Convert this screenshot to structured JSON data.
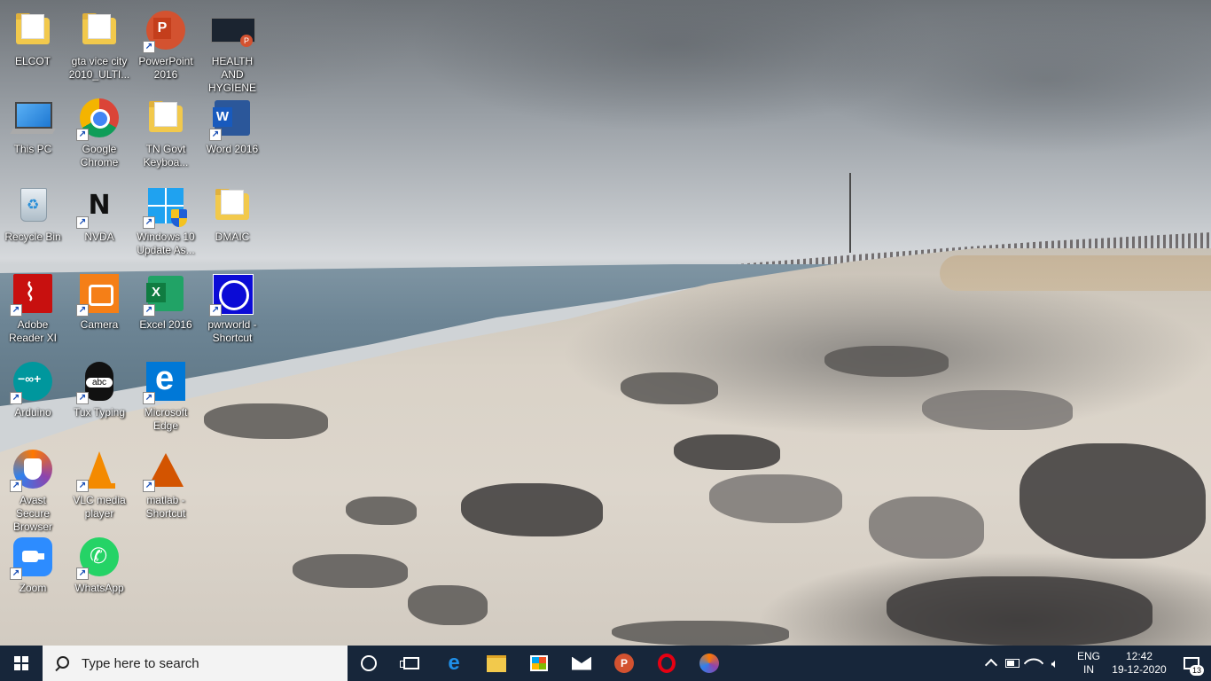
{
  "desktop": {
    "icons": [
      {
        "label": "ELCOT",
        "icon": "folder-user-icon"
      },
      {
        "label": "gta vice city 2010_ULTI...",
        "icon": "folder-icon"
      },
      {
        "label": "PowerPoint 2016",
        "icon": "powerpoint-icon"
      },
      {
        "label": "HEALTH AND HYGIENE",
        "icon": "pptx-file-icon"
      },
      {
        "label": "This PC",
        "icon": "computer-icon"
      },
      {
        "label": "Google Chrome",
        "icon": "chrome-icon"
      },
      {
        "label": "TN Govt Keyboa...",
        "icon": "folder-icon"
      },
      {
        "label": "Word 2016",
        "icon": "word-icon"
      },
      {
        "label": "Recycle Bin",
        "icon": "recycle-bin-icon"
      },
      {
        "label": "NVDA",
        "icon": "nvda-icon"
      },
      {
        "label": "Windows 10 Update As...",
        "icon": "windows-update-icon"
      },
      {
        "label": "DMAIC",
        "icon": "folder-icon"
      },
      {
        "label": "Adobe Reader XI",
        "icon": "adobe-reader-icon"
      },
      {
        "label": "Camera",
        "icon": "camera-icon"
      },
      {
        "label": "Excel 2016",
        "icon": "excel-icon"
      },
      {
        "label": "pwrworld - Shortcut",
        "icon": "pwrworld-icon"
      },
      {
        "label": "Arduino",
        "icon": "arduino-icon"
      },
      {
        "label": "Tux Typing",
        "icon": "tux-typing-icon"
      },
      {
        "label": "Microsoft Edge",
        "icon": "edge-icon"
      },
      {
        "label": "Avast Secure Browser",
        "icon": "avast-browser-icon"
      },
      {
        "label": "VLC media player",
        "icon": "vlc-icon"
      },
      {
        "label": "matlab - Shortcut",
        "icon": "matlab-icon"
      },
      {
        "label": "Zoom",
        "icon": "zoom-icon"
      },
      {
        "label": "WhatsApp",
        "icon": "whatsapp-icon"
      }
    ],
    "health_thumb_text": "HEALTH AND HYGIENE"
  },
  "taskbar": {
    "search_placeholder": "Type here to search",
    "pinned": [
      "cortana-icon",
      "task-view-icon",
      "edge-icon",
      "file-explorer-icon",
      "store-icon",
      "mail-icon",
      "powerpoint-icon",
      "opera-icon",
      "avast-browser-icon"
    ],
    "ppt_letter": "P",
    "tray": {
      "lang_line1": "ENG",
      "lang_line2": "IN",
      "time": "12:42",
      "date": "19-12-2020",
      "notification_count": "13"
    }
  },
  "colors": {
    "taskbar_bg": "#17263a",
    "search_bg": "#f3f3f3"
  }
}
